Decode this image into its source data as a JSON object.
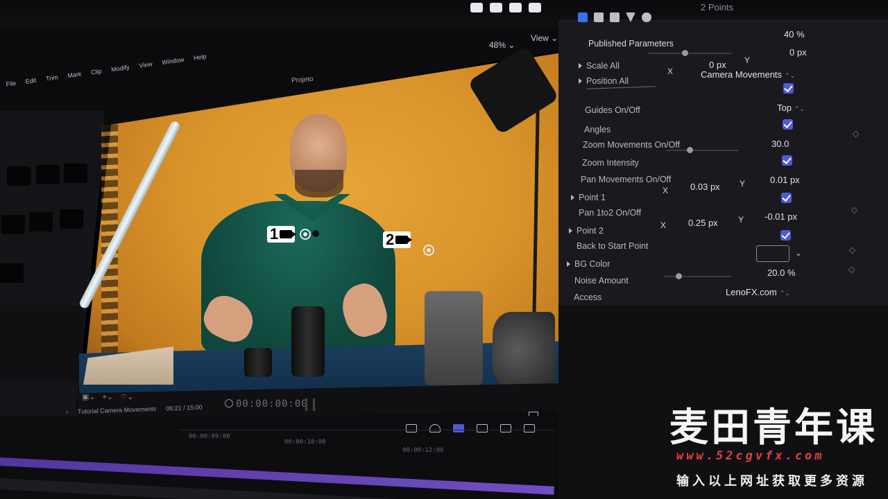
{
  "menu": {
    "items": [
      "File",
      "Edit",
      "Trim",
      "Mark",
      "Clip",
      "Modify",
      "View",
      "Window",
      "Help"
    ]
  },
  "header": {
    "project": "Projeto",
    "zoom": "48% ⌄",
    "view": "View ⌄",
    "points": "2 Points"
  },
  "viewer": {
    "timecode": "00:00:00:00",
    "marker_1": "1",
    "marker_2": "2"
  },
  "timeline": {
    "project_name": "Tutorial Camera Movements",
    "duration": "06:21 / 15:00",
    "ruler": [
      "00:00:09:00",
      "00:00:10:00",
      "00:00:12:00"
    ]
  },
  "inspector": {
    "published_parameters": "Published Parameters",
    "scale_all": {
      "label": "Scale All",
      "value": "40",
      "unit": "%"
    },
    "position_all": {
      "label": "Position All",
      "x": "0",
      "y": "0",
      "unit": "px"
    },
    "camera_movements": "Camera Movements",
    "guides": {
      "label": "Guides On/Off",
      "value": "Top"
    },
    "angles": {
      "label": "Angles"
    },
    "zoom_movements": {
      "label": "Zoom Movements On/Off"
    },
    "zoom_intensity": {
      "label": "Zoom Intensity",
      "value": "30.0"
    },
    "pan_movements": {
      "label": "Pan Movements On/Off"
    },
    "point_1": {
      "label": "Point 1",
      "x": "0.03",
      "y": "0.01",
      "unit": "px"
    },
    "pan_1to2": {
      "label": "Pan 1to2 On/Off"
    },
    "point_2": {
      "label": "Point 2",
      "x": "0.25",
      "y": "-0.01",
      "unit": "px"
    },
    "back_to_start": {
      "label": "Back to Start Point"
    },
    "bg_color": {
      "label": "BG Color"
    },
    "noise_amount": {
      "label": "Noise Amount",
      "value": "20.0",
      "unit": "%"
    },
    "access": {
      "label": "Access",
      "value": "LenoFX.com"
    }
  },
  "watermark": {
    "title": "麦田青年课",
    "url": "www.52cgvfx.com",
    "subtitle": "输入以上网址获取更多资源"
  },
  "colors": {
    "accent": "#4e5ad8",
    "backdrop": "#d8922a",
    "panel": "#1a1a1e"
  }
}
